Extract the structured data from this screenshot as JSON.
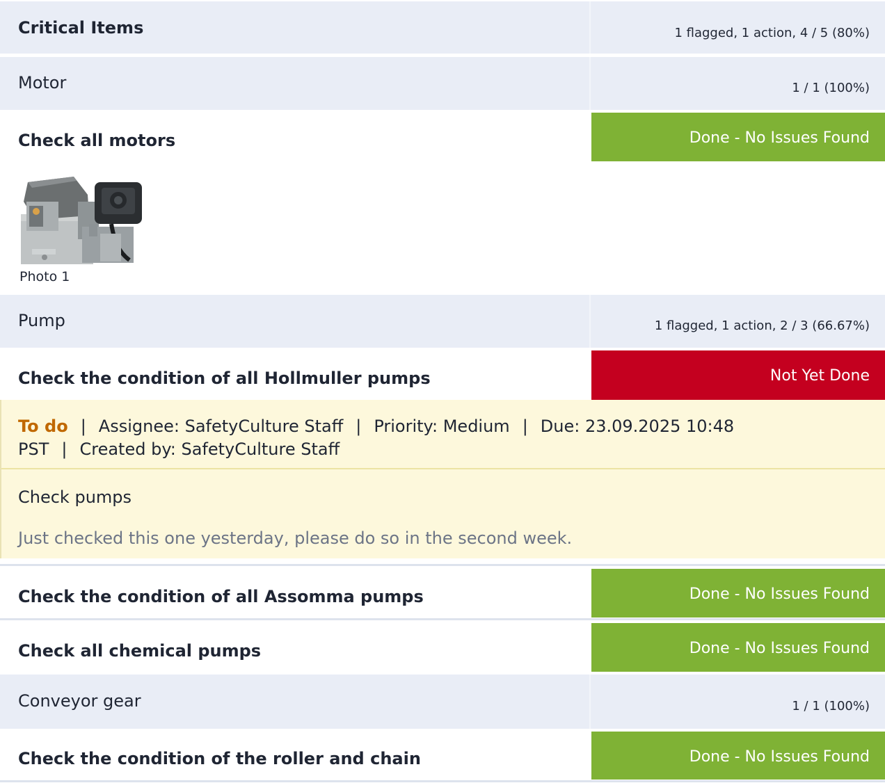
{
  "section": {
    "title": "Critical Items",
    "summary": "1 flagged, 1 action, 4 / 5 (80%)"
  },
  "groups": {
    "motor": {
      "title": "Motor",
      "summary": "1 / 1 (100%)",
      "items": [
        {
          "question": "Check all motors",
          "response": "Done - No Issues Found",
          "photo_label": "Photo 1"
        }
      ]
    },
    "pump": {
      "title": "Pump",
      "summary": "1 flagged, 1 action, 2 / 3 (66.67%)",
      "items": [
        {
          "question": "Check the condition of all Hollmuller pumps",
          "response": "Not Yet Done"
        },
        {
          "question": "Check the condition of all Assomma pumps",
          "response": "Done - No Issues Found"
        },
        {
          "question": "Check all chemical pumps",
          "response": "Done - No Issues Found"
        }
      ],
      "action": {
        "status": "To do",
        "assignee": "Assignee: SafetyCulture Staff",
        "priority": "Priority: Medium",
        "due": "Due: 23.09.2025 10:48 PST",
        "created_by": "Created by: SafetyCulture Staff",
        "separator": "|",
        "title": "Check pumps",
        "note": "Just checked this one yesterday, please do so in the second week."
      }
    },
    "conveyor": {
      "title": "Conveyor gear",
      "summary": "1 / 1 (100%)",
      "items": [
        {
          "question": "Check the condition of the roller and chain",
          "response": "Done - No Issues Found"
        }
      ]
    }
  },
  "colors": {
    "band": "#e9edf6",
    "ok": "#7fb235",
    "bad": "#c4001f",
    "action_bg": "#fdf8dc",
    "todo": "#c06800"
  }
}
